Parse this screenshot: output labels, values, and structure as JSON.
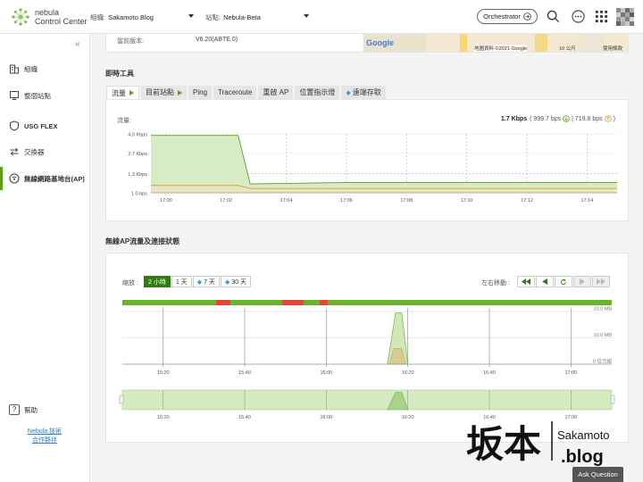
{
  "header": {
    "brand_line1": "nebula",
    "brand_line2": "Control Center",
    "org_label": "組織:",
    "org_value": "Sakamoto.Blog",
    "site_label": "站點:",
    "site_value": "Nebula-Beta",
    "orchestrator_label": "Orchestrator"
  },
  "sidebar": {
    "items": [
      {
        "label": "組織"
      },
      {
        "label": "整個站點"
      },
      {
        "label": "USG FLEX"
      },
      {
        "label": "交換器"
      },
      {
        "label": "無線網路基地台(AP)"
      }
    ],
    "help_label": "幫助",
    "partner_line1": "Nebula 技術",
    "partner_line2": "合作夥伴"
  },
  "info": {
    "firmware_label": "當前版本:",
    "firmware_value": "V6.20(ABTE.0)",
    "map_brand": "Google",
    "map_copyright": "地圖資料 ©2021 Google",
    "map_scale": "10 公尺",
    "map_terms": "使用條款"
  },
  "tools": {
    "title": "即時工具",
    "tabs": [
      "流量",
      "目前站點",
      "Ping",
      "Traceroute",
      "重啟 AP",
      "位置指示燈",
      "遠端存取"
    ],
    "traffic_label": "流量:",
    "rate_total": "1.7 Kbps",
    "rate_down": "( 999.7 bps",
    "rate_up": "| 719.8 bps",
    "rate_close": ")",
    "colors": {
      "download": "#5a9e1d",
      "upload": "#c9a53a",
      "fill": "#d7ecc4"
    }
  },
  "traffic_chart": {
    "chart_data": {
      "type": "area",
      "y_unit": "Kbps",
      "yticks": [
        "4.0 Kbps",
        "2.7 Kbps",
        "1.3 Kbps",
        "1.0 bps"
      ],
      "xticks": [
        "17:00",
        "17:02",
        "17:04",
        "17:06",
        "17:08",
        "17:10",
        "17:12",
        "17:14"
      ],
      "series": [
        {
          "values_x": [
            "16:59.5",
            "17:02.4",
            "17:02.8",
            "17:06",
            "17:15"
          ],
          "values": [
            3.9,
            3.9,
            0.6,
            0.7,
            0.7
          ]
        },
        {
          "values_x": [
            "16:59.5",
            "17:02.4",
            "17:02.8",
            "17:15"
          ],
          "values": [
            0.5,
            0.5,
            0.3,
            0.3
          ]
        }
      ],
      "ylim": [
        0,
        4.0
      ]
    }
  },
  "ap_status": {
    "title": "無線AP流量及連接狀態",
    "zoom_label": "縮放 :",
    "zoom_options": [
      "2 小時",
      "1 天",
      "7 天",
      "30 天"
    ],
    "move_label": "左右移動 :",
    "chart_data": {
      "type": "area",
      "xticks": [
        "15:20",
        "15:40",
        "16:00",
        "16:20",
        "16:40",
        "17:00"
      ],
      "yticks": [
        "20.0 MB",
        "10.0 MB",
        "0 位元組"
      ],
      "series": [
        {
          "name": "",
          "values_x": [
            "16:15",
            "16:17",
            "16:18.5",
            "16:20"
          ],
          "values": [
            0,
            19.5,
            19.5,
            0
          ]
        }
      ],
      "ylim": [
        0,
        20
      ],
      "status_bar": [
        {
          "state": "up"
        },
        {
          "state": "down"
        },
        {
          "state": "up"
        },
        {
          "state": "down"
        },
        {
          "state": "up"
        },
        {
          "state": "down"
        },
        {
          "state": "up"
        }
      ],
      "colors": {
        "up": "#6cb32d",
        "down": "#e0463a"
      }
    }
  },
  "watermark": {
    "chinese": "坂本",
    "latin": "Sakamoto",
    "domain": ".blog"
  },
  "ask_question": "Ask Question"
}
